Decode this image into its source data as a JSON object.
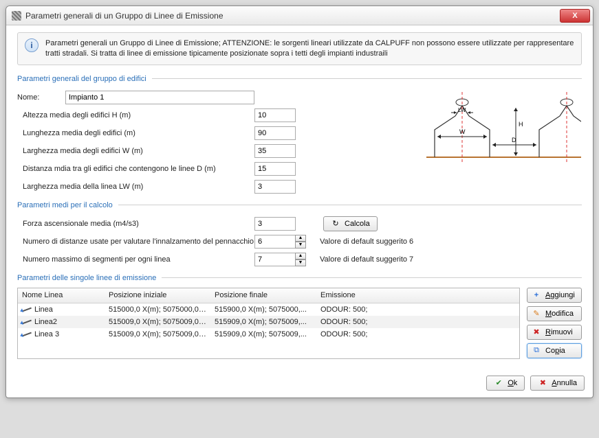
{
  "window": {
    "title": "Parametri generali di un Gruppo di Linee di Emissione",
    "close": "X"
  },
  "info": {
    "text": "Parametri generali un Gruppo di Linee di Emissione; ATTENZIONE: le sorgenti lineari utilizzate da CALPUFF non possono essere utilizzate per rappresentare tratti stradali. Si tratta di linee di emissione tipicamente posizionate sopra i tetti degli impianti industraili"
  },
  "sec1": {
    "title": "Parametri generali del gruppo di edifici",
    "nome_label": "Nome:",
    "nome_value": "Impianto 1",
    "rows": [
      {
        "label": "Altezza media degli edifici H (m)",
        "value": "10"
      },
      {
        "label": "Lunghezza media degli edifici (m)",
        "value": "90"
      },
      {
        "label": "Larghezza media degli edifici W (m)",
        "value": "35"
      },
      {
        "label": "Distanza mdia tra gli edifici che contengono le linee D (m)",
        "value": "15"
      },
      {
        "label": "Larghezza media della  linea LW (m)",
        "value": "3"
      }
    ]
  },
  "sec2": {
    "title": "Parametri medi per il calcolo",
    "force_label": "Forza ascensionale media (m4/s3)",
    "force_value": "3",
    "calc_label": "Calcola",
    "dist_label": "Numero di distanze usate per valutare l'innalzamento del pennacchio",
    "dist_value": "6",
    "dist_hint": "Valore di default suggerito 6",
    "seg_label": "Numero massimo di segmenti per ogni linea",
    "seg_value": "7",
    "seg_hint": "Valore di default suggerito 7"
  },
  "sec3": {
    "title": "Parametri delle singole linee di emissione",
    "headers": {
      "c1": "Nome Linea",
      "c2": "Posizione iniziale",
      "c3": "Posizione finale",
      "c4": "Emissione"
    },
    "rows": [
      {
        "name": "Linea",
        "p1": "515000,0 X(m); 5075000,0 ...",
        "p2": "515900,0 X(m); 5075000,...",
        "em": "ODOUR: 500;"
      },
      {
        "name": "Linea2",
        "p1": "515009,0 X(m); 5075009,0 ...",
        "p2": "515909,0 X(m); 5075009,...",
        "em": "ODOUR: 500;"
      },
      {
        "name": "Linea 3",
        "p1": "515009,0 X(m); 5075009,0 ...",
        "p2": "515909,0 X(m); 5075009,...",
        "em": "ODOUR: 500;"
      }
    ],
    "buttons": {
      "add": "Aggiungi",
      "edit": "Modifica",
      "remove": "Rimuovi",
      "copy": "Copia"
    }
  },
  "footer": {
    "ok": "Ok",
    "cancel": "Annulla"
  },
  "diagram": {
    "labels": {
      "LW": "LW",
      "W": "W",
      "H": "H",
      "D": "D"
    }
  }
}
